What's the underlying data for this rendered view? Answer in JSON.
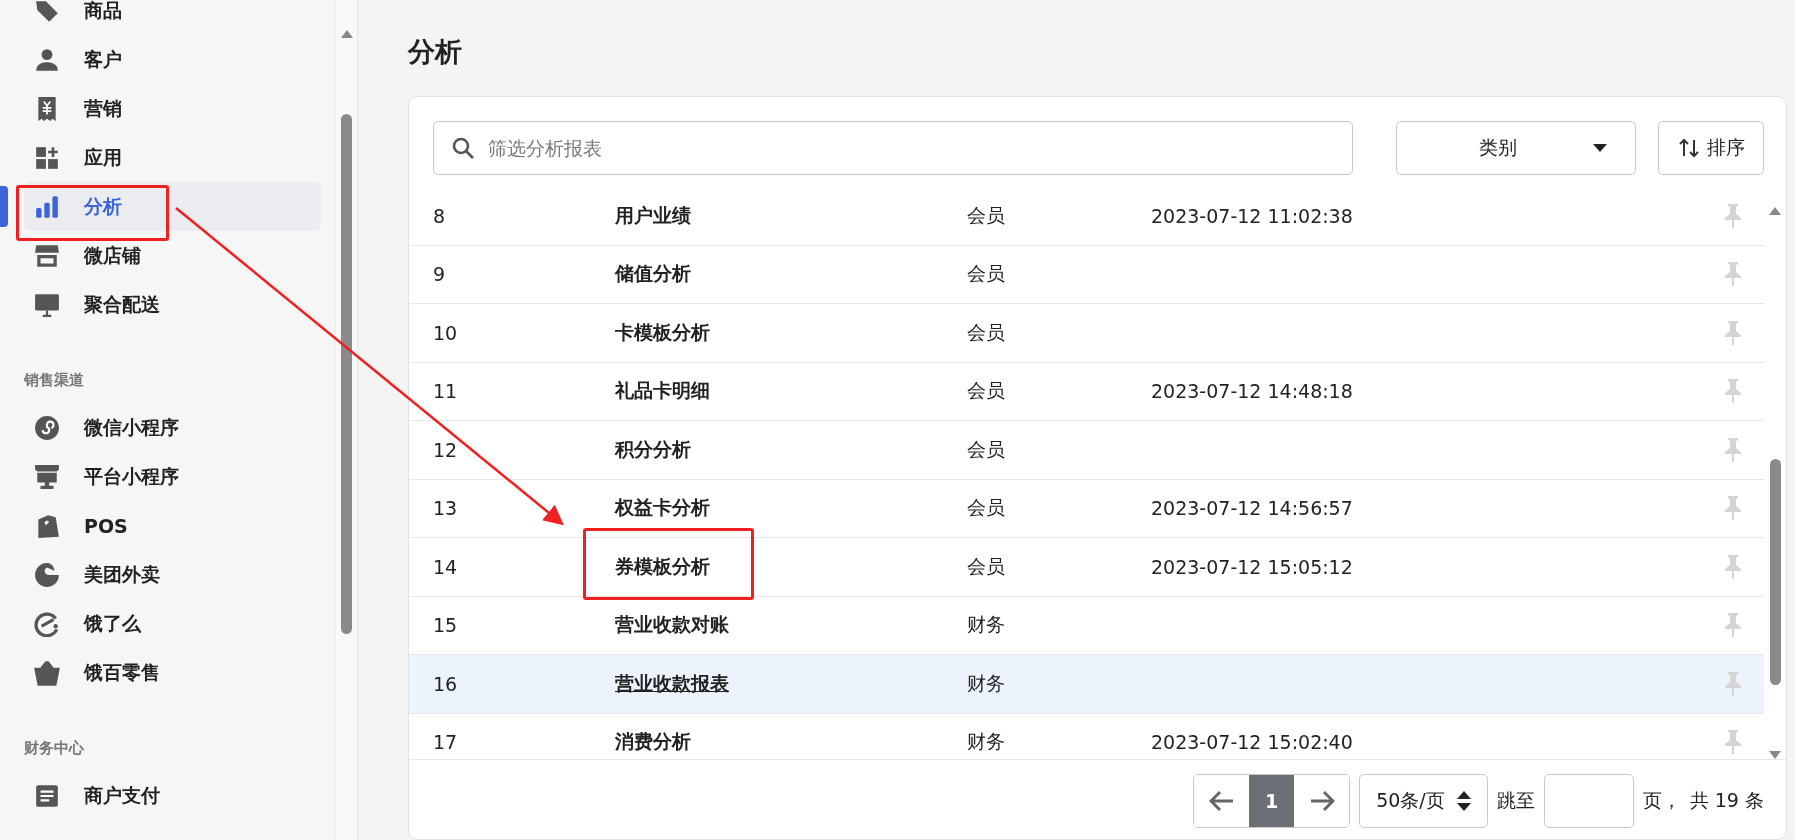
{
  "sidebar": {
    "groups": [
      {
        "items": [
          {
            "label": "商品",
            "selected": false
          },
          {
            "label": "客户",
            "selected": false
          },
          {
            "label": "营销",
            "selected": false
          },
          {
            "label": "应用",
            "selected": false
          },
          {
            "label": "分析",
            "selected": true
          },
          {
            "label": "微店铺",
            "selected": false
          },
          {
            "label": "聚合配送",
            "selected": false
          }
        ]
      },
      {
        "heading": "销售渠道",
        "items": [
          {
            "label": "微信小程序",
            "selected": false
          },
          {
            "label": "平台小程序",
            "selected": false
          },
          {
            "label": "POS",
            "selected": false
          },
          {
            "label": "美团外卖",
            "selected": false
          },
          {
            "label": "饿了么",
            "selected": false
          },
          {
            "label": "饿百零售",
            "selected": false
          }
        ]
      },
      {
        "heading": "财务中心",
        "items": [
          {
            "label": "商户支付",
            "selected": false
          }
        ]
      }
    ]
  },
  "page": {
    "title": "分析"
  },
  "toolbar": {
    "search": {
      "placeholder": "筛选分析报表"
    },
    "category": "类别",
    "sort": "排序"
  },
  "table": {
    "rows": [
      {
        "index": "8",
        "name": "用户业绩",
        "category": "会员",
        "time": "2023-07-12 11:02:38",
        "selected": false
      },
      {
        "index": "9",
        "name": "储值分析",
        "category": "会员",
        "time": null,
        "selected": false
      },
      {
        "index": "10",
        "name": "卡模板分析",
        "category": "会员",
        "time": null,
        "selected": false
      },
      {
        "index": "11",
        "name": "礼品卡明细",
        "category": "会员",
        "time": "2023-07-12 14:48:18",
        "selected": false
      },
      {
        "index": "12",
        "name": "积分分析",
        "category": "会员",
        "time": null,
        "selected": false
      },
      {
        "index": "13",
        "name": "权益卡分析",
        "category": "会员",
        "time": "2023-07-12 14:56:57",
        "selected": false
      },
      {
        "index": "14",
        "name": "券模板分析",
        "category": "会员",
        "time": "2023-07-12 15:05:12",
        "selected": false
      },
      {
        "index": "15",
        "name": "营业收款对账",
        "category": "财务",
        "time": null,
        "selected": false
      },
      {
        "index": "16",
        "name": "营业收款报表",
        "category": "财务",
        "time": null,
        "selected": true
      },
      {
        "index": "17",
        "name": "消费分析",
        "category": "财务",
        "time": "2023-07-12 15:02:40",
        "selected": false
      }
    ]
  },
  "pagination": {
    "page": "1",
    "page_size": "50条/页",
    "jump_label": "跳至",
    "page_unit": "页，",
    "total": "共 19 条"
  }
}
